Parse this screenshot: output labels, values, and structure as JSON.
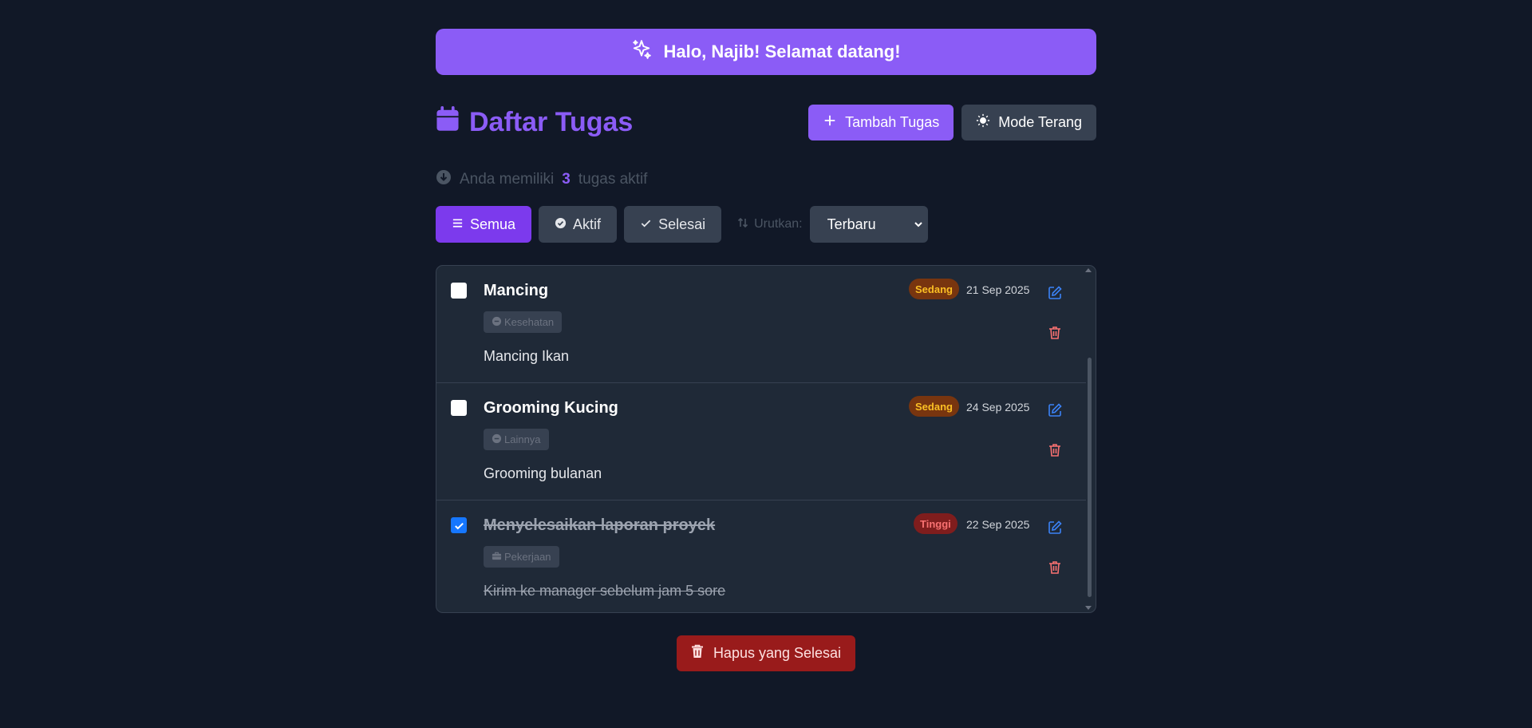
{
  "banner": {
    "icon": "sparkles-icon",
    "text": "Halo, Najib! Selamat datang!"
  },
  "header": {
    "title": "Daftar Tugas",
    "title_icon": "calendar-icon",
    "add_button": "Tambah Tugas",
    "theme_button": "Mode Terang"
  },
  "summary": {
    "prefix": "Anda memiliki",
    "count": "3",
    "suffix": "tugas aktif"
  },
  "filters": {
    "all": "Semua",
    "active": "Aktif",
    "done": "Selesai",
    "sort_label": "Urutkan:",
    "sort_value": "Terbaru"
  },
  "tasks": [
    {
      "title": "Mancing",
      "category": "Kesehatan",
      "description": "Mancing Ikan",
      "priority": "Sedang",
      "date": "21 Sep 2025",
      "completed": false
    },
    {
      "title": "Grooming Kucing",
      "category": "Lainnya",
      "description": "Grooming bulanan",
      "priority": "Sedang",
      "date": "24 Sep 2025",
      "completed": false
    },
    {
      "title": "Menyelesaikan laporan proyek",
      "category": "Pekerjaan",
      "description": "Kirim ke manager sebelum jam 5 sore",
      "priority": "Tinggi",
      "date": "22 Sep 2025",
      "completed": true
    }
  ],
  "clear_button": "Hapus yang Selesai",
  "colors": {
    "accent": "#8b5cf6",
    "background": "#111827",
    "card": "#1f2937",
    "danger": "#991b1b"
  }
}
